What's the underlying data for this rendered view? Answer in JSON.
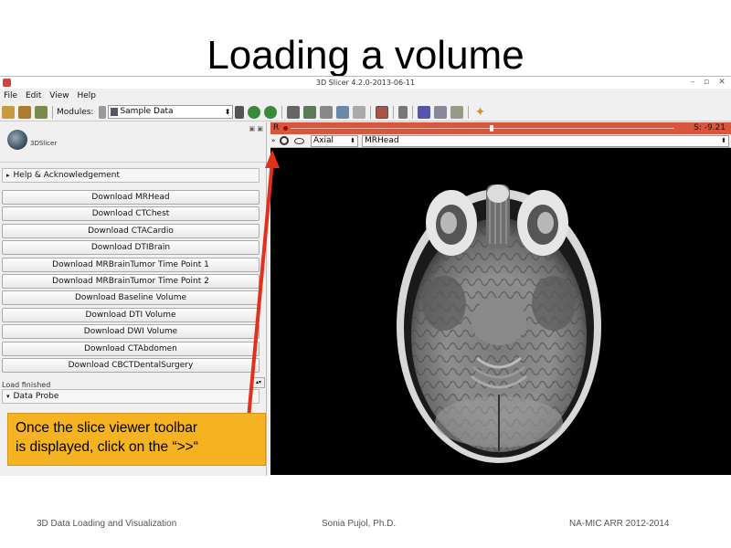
{
  "slide": {
    "title": "Loading a volume",
    "callout_line1": "Once the slice viewer toolbar",
    "callout_line2": "is displayed, click on the “>>“",
    "footer_left": "3D Data Loading and Visualization",
    "footer_center": "Sonia Pujol, Ph.D.",
    "footer_right": "NA-MIC ARR 2012-2014"
  },
  "window": {
    "title": "3D Slicer 4.2.0-2013-06-11"
  },
  "menu": [
    "File",
    "Edit",
    "View",
    "Help"
  ],
  "toolbar": {
    "modules_label": "Modules:",
    "module_selected": "Sample Data"
  },
  "panel": {
    "logo_text": "3DSlicer",
    "help_section": "Help & Acknowledgement",
    "buttons": [
      "Download MRHead",
      "Download CTChest",
      "Download CTACardio",
      "Download DTIBrain",
      "Download MRBrainTumor Time Point 1",
      "Download MRBrainTumor Time Point 2",
      "Download Baseline Volume",
      "Download DTI Volume",
      "Download DWI Volume",
      "Download CTAbdomen",
      "Download CBCTDentalSurgery"
    ],
    "status": "Load finished",
    "data_probe": "Data Probe"
  },
  "slice_viewer": {
    "slider_label": "R",
    "offset": "S: -9.21",
    "more_button": "»",
    "orientation": "Axial",
    "volume": "MRHead"
  },
  "colors": {
    "slider_red": "#d9563e",
    "callout_orange": "#f5b321",
    "arrow_red": "#e0301e"
  }
}
